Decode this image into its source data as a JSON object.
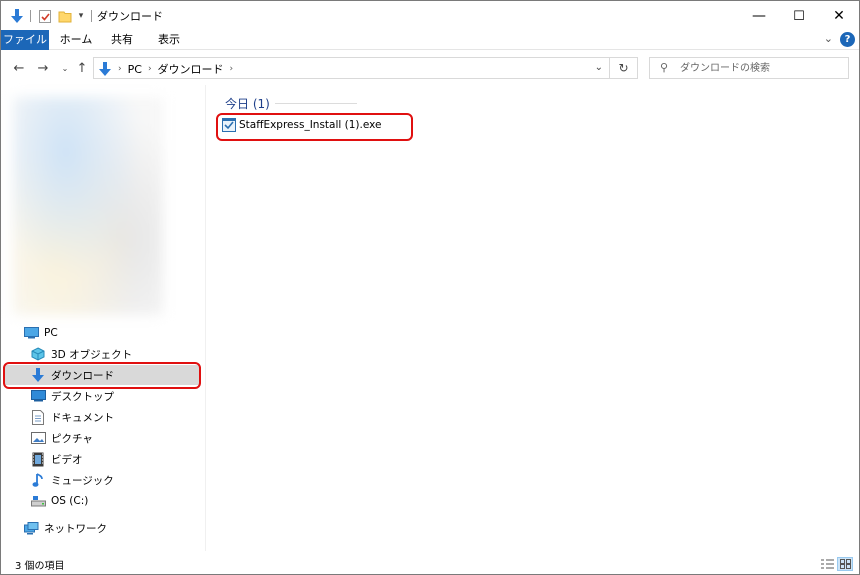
{
  "window": {
    "title": "ダウンロード",
    "minimize": "—",
    "maximize": "☐",
    "close": "✕"
  },
  "ribbon": {
    "tabs": [
      "ファイル",
      "ホーム",
      "共有",
      "表示"
    ],
    "help": "?"
  },
  "address": {
    "crumbs": [
      "PC",
      "ダウンロード"
    ],
    "search_placeholder": "ダウンロードの検索"
  },
  "sidebar": {
    "items": [
      {
        "label": "PC",
        "icon": "pc-icon"
      },
      {
        "label": "3D オブジェクト",
        "icon": "3d-objects-icon"
      },
      {
        "label": "ダウンロード",
        "icon": "download-icon",
        "selected": true
      },
      {
        "label": "デスクトップ",
        "icon": "desktop-icon"
      },
      {
        "label": "ドキュメント",
        "icon": "documents-icon"
      },
      {
        "label": "ピクチャ",
        "icon": "pictures-icon"
      },
      {
        "label": "ビデオ",
        "icon": "video-icon"
      },
      {
        "label": "ミュージック",
        "icon": "music-icon"
      },
      {
        "label": "OS (C:)",
        "icon": "drive-icon"
      },
      {
        "label": "ネットワーク",
        "icon": "network-icon"
      }
    ]
  },
  "content": {
    "group_label": "今日 (1)",
    "files": [
      {
        "name": "StaffExpress_Install (1).exe",
        "icon": "installer-icon"
      }
    ]
  },
  "status": {
    "item_count": "3 個の項目"
  },
  "colors": {
    "accent": "#1c67b8",
    "highlight": "#e01010",
    "group_header": "#1e3f8a",
    "selected_bg": "#d9d9d9"
  }
}
